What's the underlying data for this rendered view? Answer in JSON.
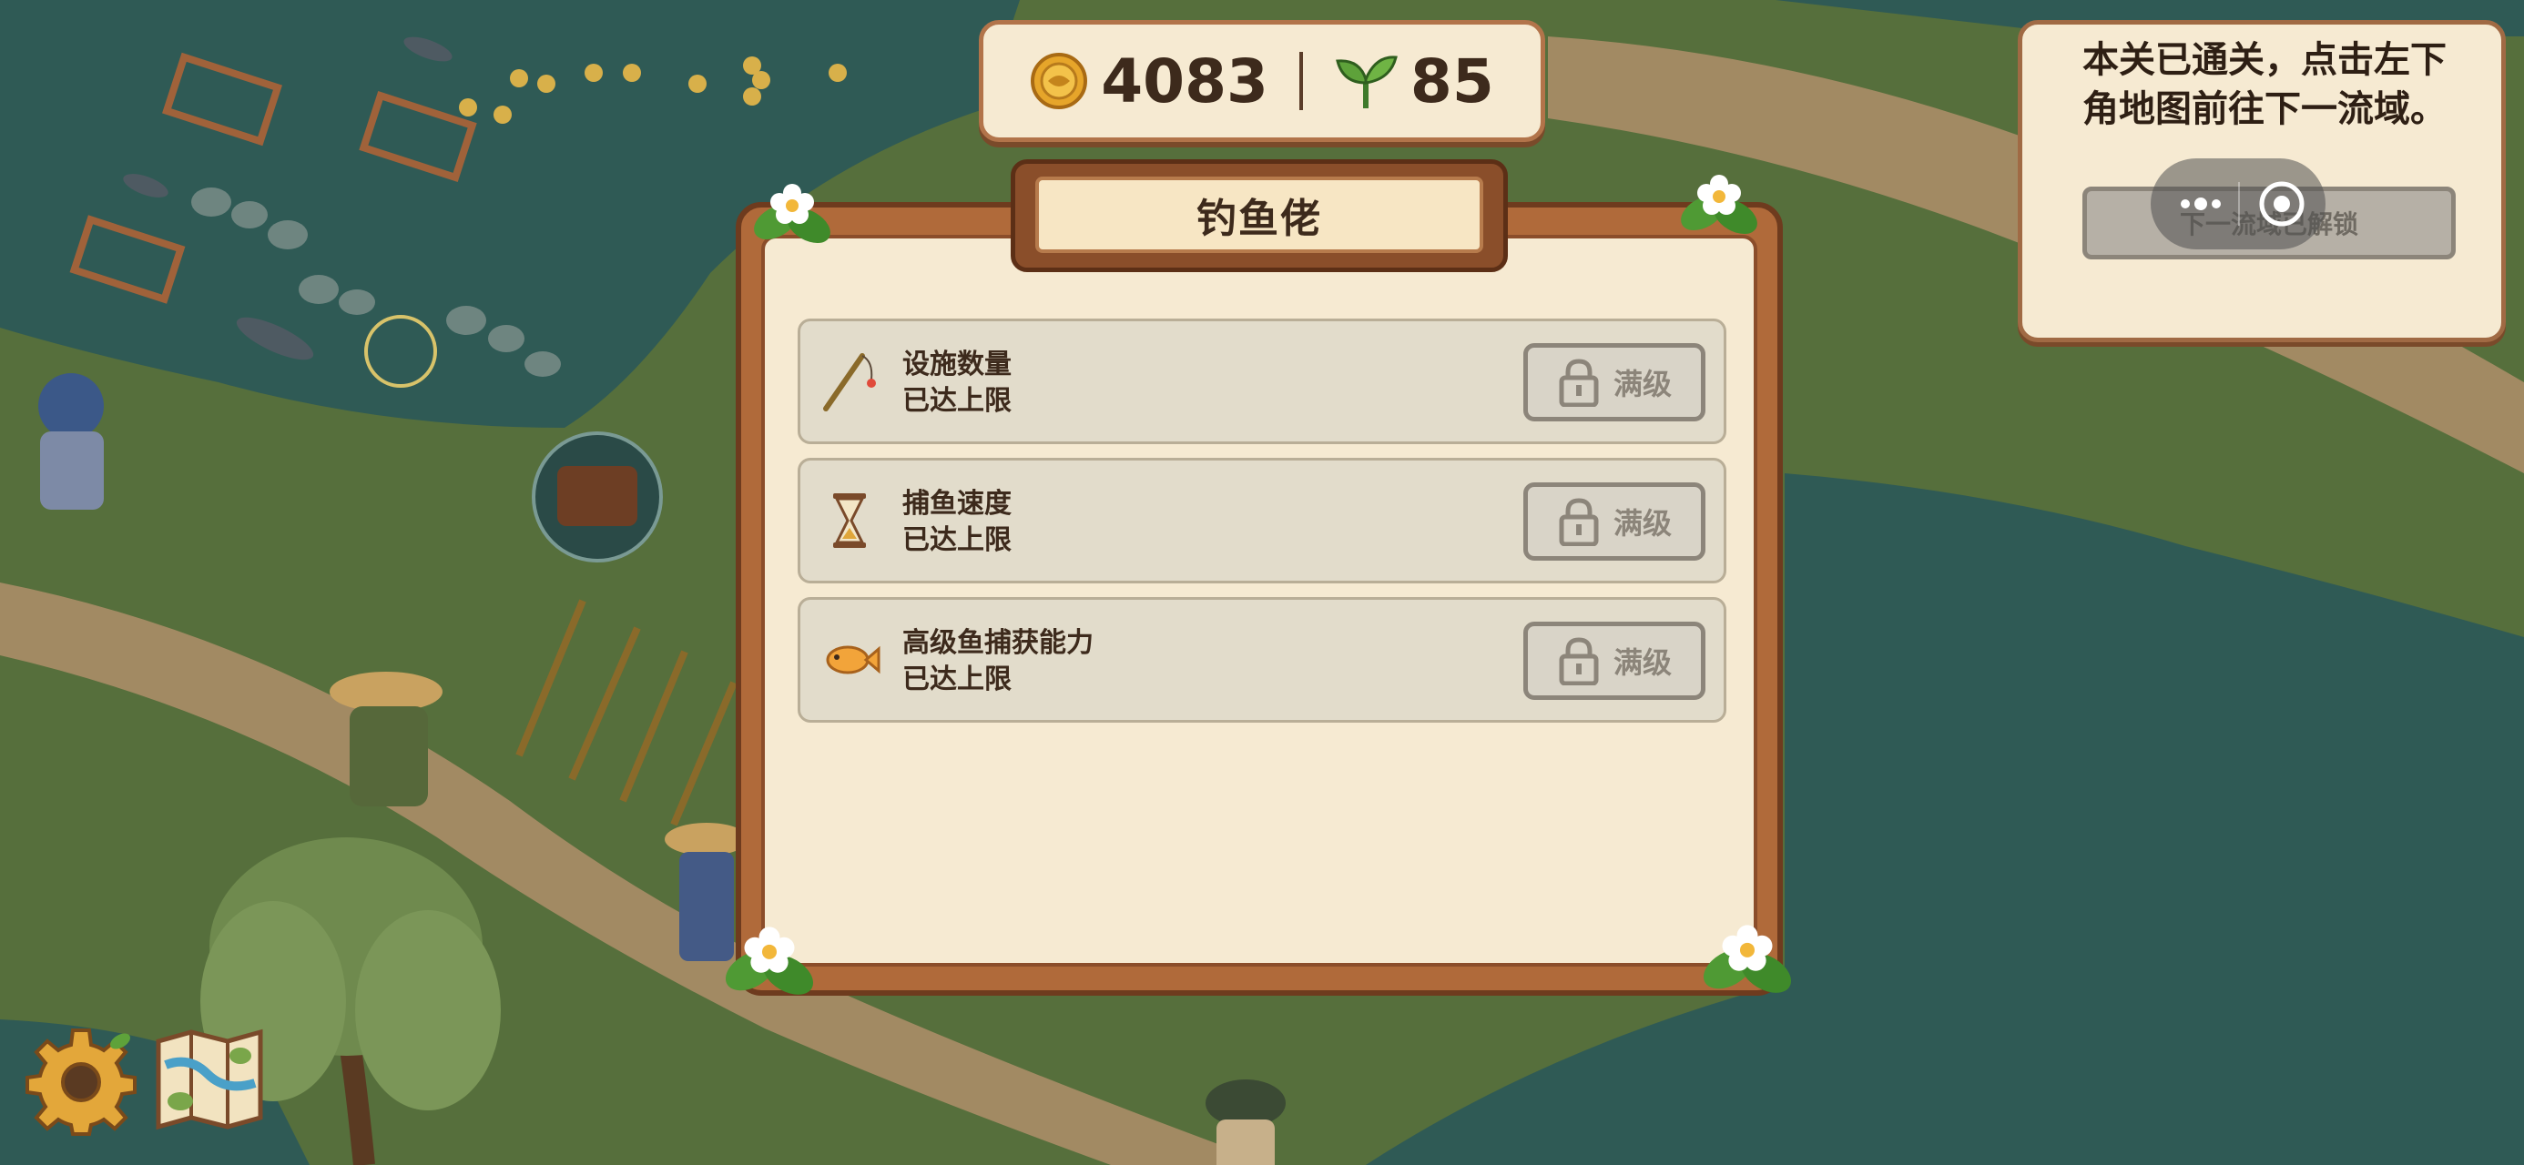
{
  "hud": {
    "coins": "4083",
    "sprouts": "85",
    "coin_icon": "gold-coin-icon",
    "sprout_icon": "sprout-leaf-icon"
  },
  "panel": {
    "title": "钓鱼佬",
    "rows": [
      {
        "icon": "fishing-rod-icon",
        "name": "设施数量",
        "status": "已达上限",
        "button": "满级"
      },
      {
        "icon": "hourglass-icon",
        "name": "捕鱼速度",
        "status": "已达上限",
        "button": "满级"
      },
      {
        "icon": "goldfish-icon",
        "name": "高级鱼捕获能力",
        "status": "已达上限",
        "button": "满级"
      }
    ]
  },
  "hint": {
    "text": "本关已通关，点击左下角地图前往下一流域。",
    "button": "下一流域已解锁"
  },
  "bottom_left": {
    "settings_icon": "gear-icon",
    "map_icon": "map-icon"
  },
  "colors": {
    "river": "#2f5a55",
    "grass": "#566f3c",
    "path": "#a28a63",
    "panel_frame": "#b06a3a",
    "panel_paper": "#f6ead2",
    "row_bg": "#e2dccb",
    "disabled_button": "#8c857a"
  }
}
